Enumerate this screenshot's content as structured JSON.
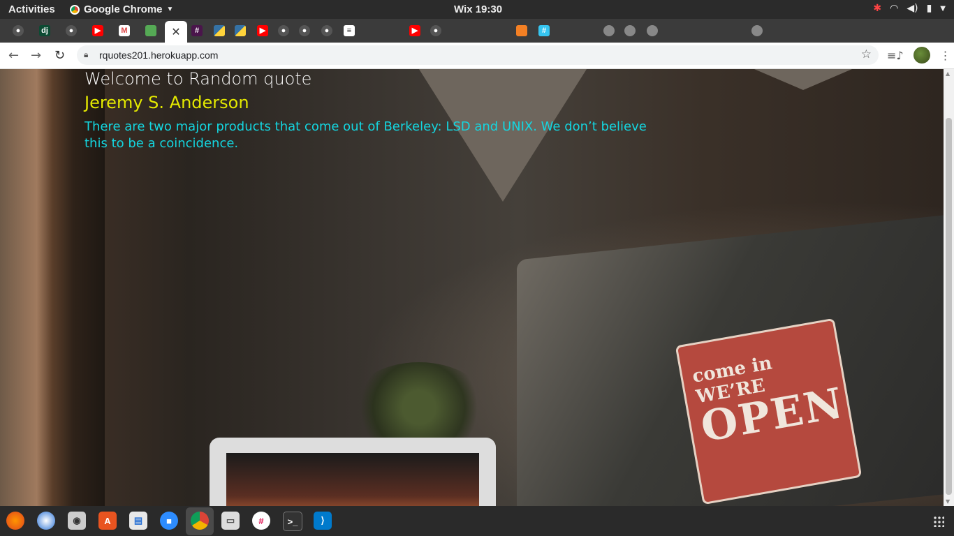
{
  "system_bar": {
    "activities": "Activities",
    "app_name": "Google Chrome",
    "clock": "Wix 19:30"
  },
  "browser": {
    "url": "rquotes201.herokuapp.com",
    "tabs": [
      {
        "icon": "github-icon"
      },
      {
        "icon": "django-icon",
        "text": "dj"
      },
      {
        "icon": "github-icon"
      },
      {
        "icon": "youtube-icon"
      },
      {
        "icon": "gmail-icon",
        "text": "M"
      },
      {
        "icon": "generic-tab-icon"
      },
      {
        "icon": "close-icon",
        "text": "×",
        "active": true
      },
      {
        "icon": "slack-icon"
      },
      {
        "icon": "python-icon"
      },
      {
        "icon": "python-icon"
      },
      {
        "icon": "youtube-icon"
      },
      {
        "icon": "github-icon"
      },
      {
        "icon": "github-icon"
      },
      {
        "icon": "github-icon"
      },
      {
        "icon": "list-icon"
      }
    ]
  },
  "page": {
    "welcome": "Welcome to Random quote",
    "author": "Jeremy S. Anderson",
    "quote": "There are two major products that come out of Berkeley: LSD and UNIX. We don’t believe this to be a coincidence."
  },
  "background": {
    "sign_line1": "come in WE’RE",
    "sign_line2": "OPEN"
  },
  "colors": {
    "author": "#e4e900",
    "quote": "#14d6e0",
    "welcome": "#ffffff"
  },
  "dock": {
    "apps": [
      "firefox-icon",
      "thunderbird-icon",
      "screenshot-icon",
      "software-center-icon",
      "text-editor-icon",
      "zoom-icon",
      "chrome-icon",
      "files-icon",
      "slack-icon",
      "terminal-icon",
      "vscode-icon",
      "show-apps-icon"
    ]
  }
}
